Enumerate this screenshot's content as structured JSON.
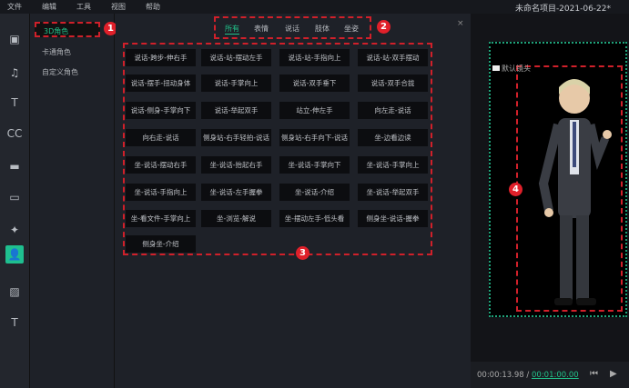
{
  "menu": [
    "文件",
    "编辑",
    "工具",
    "视图",
    "帮助"
  ],
  "title": "未命名项目-2021-06-22*",
  "rail": [
    {
      "icon": "video-icon",
      "g": "▣"
    },
    {
      "icon": "music-icon",
      "g": "♫"
    },
    {
      "icon": "text-icon",
      "g": "T"
    },
    {
      "icon": "caption-icon",
      "g": "CC"
    },
    {
      "icon": "folder-icon",
      "g": "▬"
    },
    {
      "icon": "screen-icon",
      "g": "▭"
    },
    {
      "icon": "effects-icon",
      "g": "✦"
    },
    {
      "icon": "character-icon",
      "g": "👤",
      "active": true
    },
    {
      "icon": "transition-icon",
      "g": "▨"
    },
    {
      "icon": "subtitle-icon",
      "g": "T"
    }
  ],
  "categories": [
    "3D角色",
    "卡通角色",
    "自定义角色"
  ],
  "tabs": [
    "所有",
    "表情",
    "说话",
    "肢体",
    "坐姿"
  ],
  "close": "×",
  "actions": [
    "说话-跨步-伸右手",
    "说话-站-摆动左手",
    "说话-站-手指向上",
    "说话-站-双手摆动",
    "说话-摆手-扭动身体",
    "说话-手掌向上",
    "说话-双手垂下",
    "说话-双手合拢",
    "说话-侧身-手掌向下",
    "说话-举起双手",
    "站立-伸左手",
    "向左走-说话",
    "向右走-说话",
    "侧身站-右手轻拍-说话",
    "侧身站-右手向下-说话",
    "坐-边看边读",
    "坐-说话-摆动右手",
    "坐-说话-抬起右手",
    "坐-说话-手掌向下",
    "坐-说话-手掌向上",
    "坐-说话-手指向上",
    "坐-说话-左手握拳",
    "坐-说话-介绍",
    "坐-说话-举起双手",
    "坐-看文件-手掌向上",
    "坐-浏览-解说",
    "坐-摆动左手-低头看",
    "侧身坐-说话-握拳",
    "侧身坐-介绍"
  ],
  "badges": [
    "1",
    "2",
    "3",
    "4"
  ],
  "preview": {
    "camera_label": "默认镜头",
    "current_time": "00:00:13.98 /",
    "total_time": "00:01:00.00"
  },
  "colors": {
    "accent": "#21c28a",
    "annotation": "#d0202a"
  }
}
